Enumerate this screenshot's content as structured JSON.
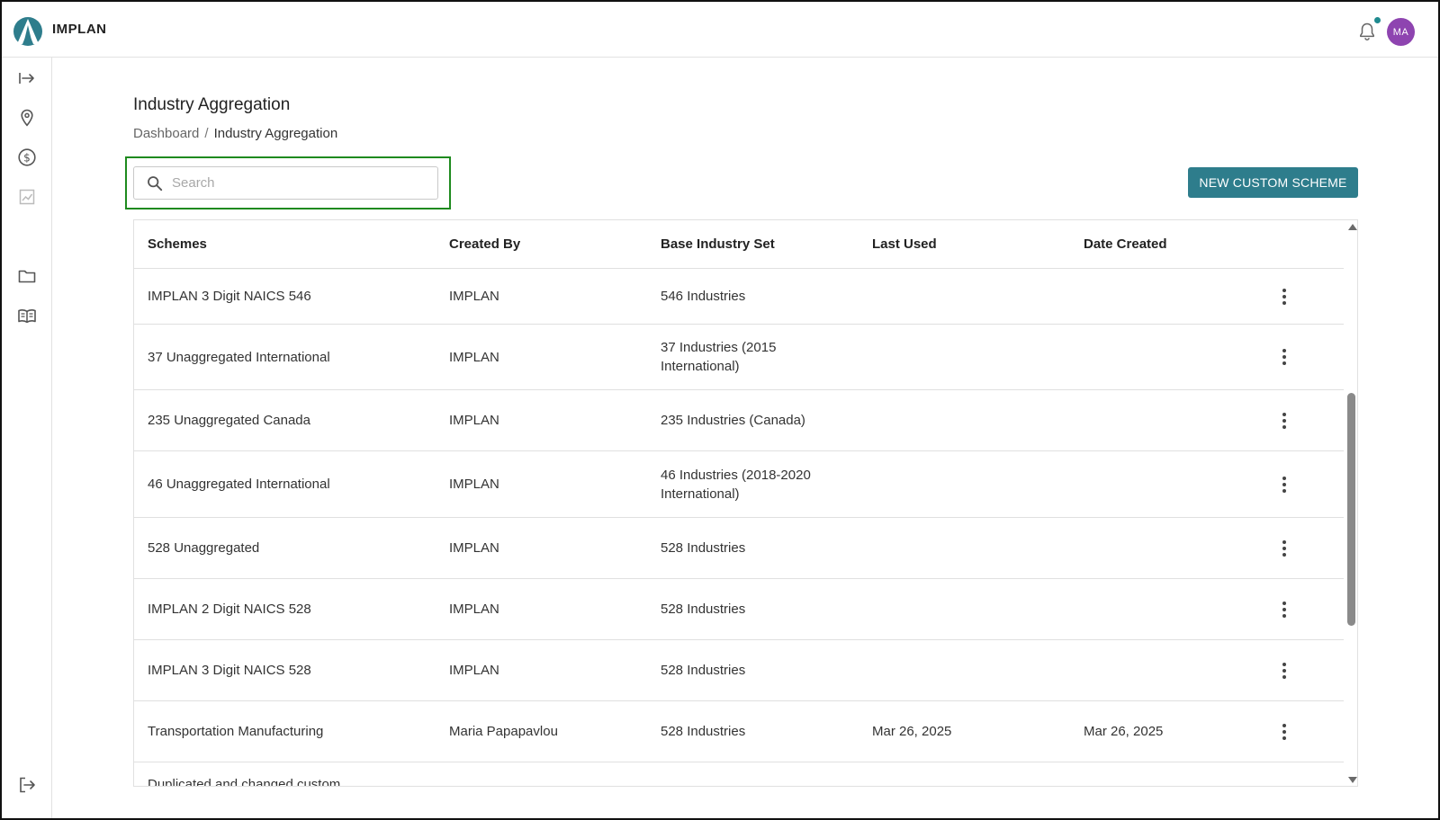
{
  "app": {
    "brand": "IMPLAN",
    "avatar_initials": "MA",
    "brand_color": "#2e7d8c",
    "avatar_color": "#8e44b0"
  },
  "sidebar": {
    "items": [
      {
        "icon": "expand-arrow-icon"
      },
      {
        "icon": "location-pin-icon"
      },
      {
        "icon": "dollar-circle-icon"
      },
      {
        "icon": "chart-icon"
      },
      {
        "icon": "folder-icon"
      },
      {
        "icon": "book-icon"
      },
      {
        "icon": "logout-icon"
      }
    ]
  },
  "page": {
    "title": "Industry Aggregation",
    "breadcrumb": {
      "root": "Dashboard",
      "separator": "/",
      "current": "Industry Aggregation"
    }
  },
  "search": {
    "placeholder": "Search",
    "value": ""
  },
  "toolbar": {
    "new_label": "NEW CUSTOM SCHEME"
  },
  "table": {
    "columns": [
      "Schemes",
      "Created By",
      "Base Industry Set",
      "Last Used",
      "Date Created"
    ],
    "rows": [
      {
        "scheme": "IMPLAN 3 Digit NAICS 546",
        "created_by": "IMPLAN",
        "base": "546 Industries",
        "last_used": "",
        "date_created": ""
      },
      {
        "scheme": "37 Unaggregated International",
        "created_by": "IMPLAN",
        "base": "37 Industries (2015 International)",
        "last_used": "",
        "date_created": ""
      },
      {
        "scheme": "235 Unaggregated Canada",
        "created_by": "IMPLAN",
        "base": "235 Industries (Canada)",
        "last_used": "",
        "date_created": ""
      },
      {
        "scheme": "46 Unaggregated International",
        "created_by": "IMPLAN",
        "base": "46 Industries (2018-2020 International)",
        "last_used": "",
        "date_created": ""
      },
      {
        "scheme": "528 Unaggregated",
        "created_by": "IMPLAN",
        "base": "528 Industries",
        "last_used": "",
        "date_created": ""
      },
      {
        "scheme": "IMPLAN 2 Digit NAICS 528",
        "created_by": "IMPLAN",
        "base": "528 Industries",
        "last_used": "",
        "date_created": ""
      },
      {
        "scheme": "IMPLAN 3 Digit NAICS 528",
        "created_by": "IMPLAN",
        "base": "528 Industries",
        "last_used": "",
        "date_created": ""
      },
      {
        "scheme": "Transportation Manufacturing",
        "created_by": "Maria Papapavlou",
        "base": "528 Industries",
        "last_used": "Mar 26, 2025",
        "date_created": "Mar 26, 2025"
      },
      {
        "scheme": "Duplicated and changed custom",
        "created_by": "",
        "base": "",
        "last_used": "",
        "date_created": ""
      }
    ]
  }
}
